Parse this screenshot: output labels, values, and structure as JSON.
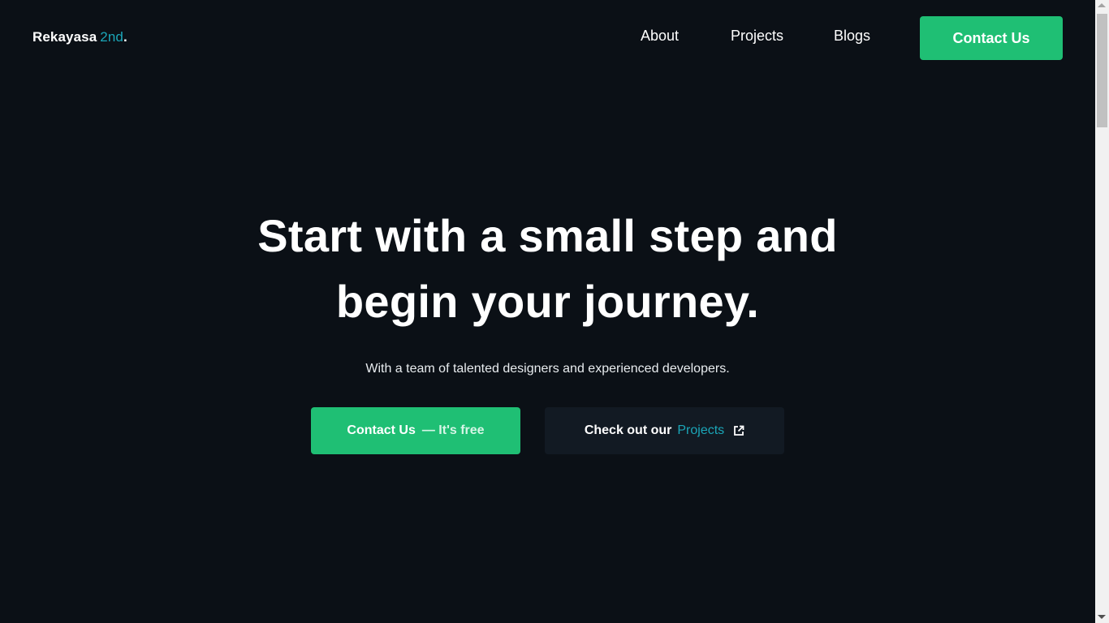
{
  "header": {
    "logo": {
      "name": "Rekayasa",
      "accent": "2nd",
      "dot": "."
    },
    "nav": [
      {
        "label": "About"
      },
      {
        "label": "Projects"
      },
      {
        "label": "Blogs"
      }
    ],
    "cta_label": "Contact Us"
  },
  "hero": {
    "title_line1": "Start with a small step and",
    "title_line2": "begin your journey.",
    "subtitle": "With a team of talented designers and experienced developers.",
    "primary_button": {
      "label": "Contact Us",
      "suffix": "— It's free"
    },
    "secondary_button": {
      "label": "Check out our",
      "accent": "Projects",
      "icon": "external-link-icon"
    }
  },
  "colors": {
    "background": "#0b1016",
    "brand_green": "#1fbf74",
    "accent_teal": "#1ba6b8",
    "secondary_button_bg": "#121a23"
  }
}
